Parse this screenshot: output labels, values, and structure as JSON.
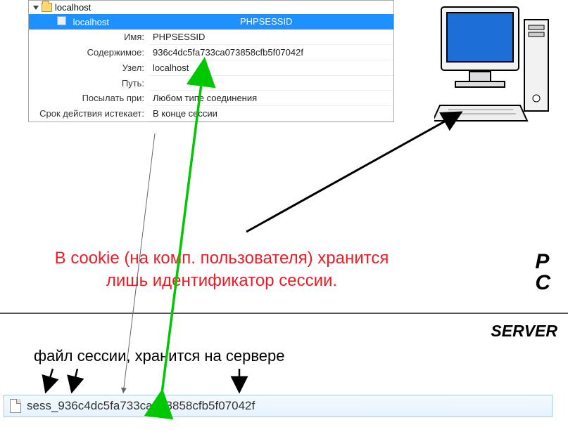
{
  "tree": {
    "root": "localhost",
    "selected_host": "localhost",
    "selected_cookie": "PHPSESSID"
  },
  "props": {
    "name_label": "Имя:",
    "name_value": "PHPSESSID",
    "content_label": "Содержимое:",
    "content_value": "936c4dc5fa733ca073858cfb5f07042f",
    "host_label": "Узел:",
    "host_value": "localhost",
    "path_label": "Путь:",
    "path_value": "",
    "send_label": "Посылать при:",
    "send_value": "Любом типе соединения",
    "expire_label": "Срок действия истекает:",
    "expire_value": "В конце сессии"
  },
  "annotations": {
    "cookie_note_line1": "В cookie (на комп. пользователя) хранится",
    "cookie_note_line2": "лишь идентификатор сессии.",
    "file_caption": "файл сессии, хранится на сервере",
    "pc_label": "P\nC",
    "server_label": "SERVER",
    "session_filename": "sess_936c4dc5fa733ca073858cfb5f07042f"
  }
}
